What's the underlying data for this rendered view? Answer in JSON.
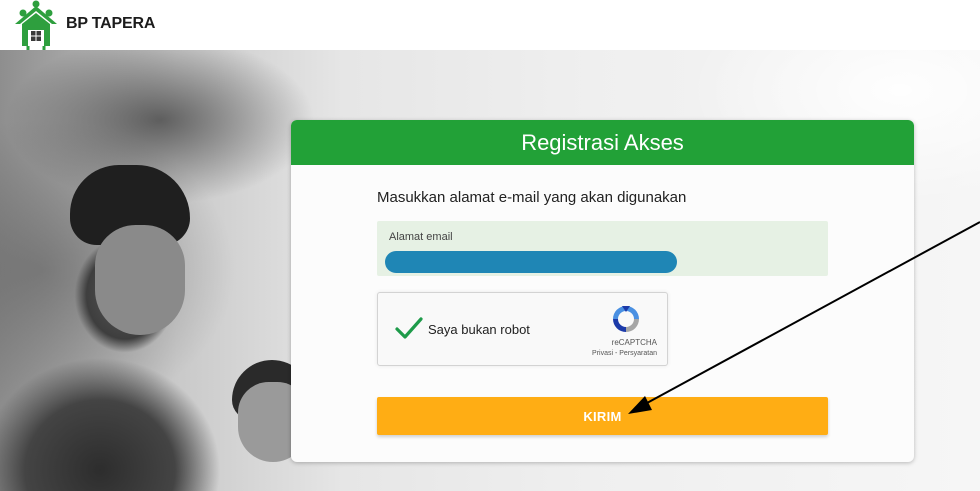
{
  "header": {
    "brand": "BP TAPERA"
  },
  "form": {
    "title": "Registrasi Akses",
    "instruction": "Masukkan alamat e-mail yang akan digunakan",
    "email": {
      "label": "Alamat email",
      "value": ""
    },
    "captcha": {
      "label": "Saya bukan robot",
      "brand": "reCAPTCHA",
      "links": "Privasi - Persyaratan",
      "checked": true
    },
    "submit_label": "KIRIM"
  },
  "colors": {
    "header_green": "#22a137",
    "submit_orange": "#ffad14",
    "email_fill": "#1f86b5"
  },
  "icons": [
    "house-people-logo-icon",
    "checkmark-icon",
    "recaptcha-icon",
    "arrow-annotation"
  ]
}
